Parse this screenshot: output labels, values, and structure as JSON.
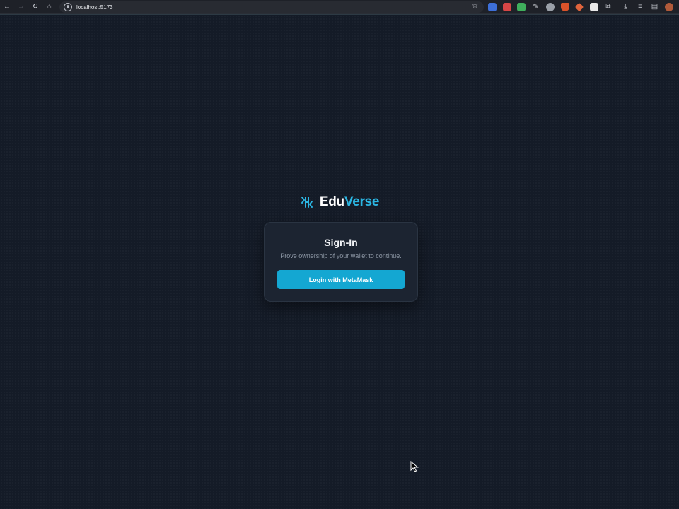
{
  "browser": {
    "url": "localhost:5173",
    "nav": {
      "back": "←",
      "forward": "→",
      "reload": "↻",
      "home": "⌂"
    },
    "bookmark_icon": "star-icon",
    "extensions": [
      {
        "name": "translate-extension-icon",
        "color": "#3d6fd8"
      },
      {
        "name": "red-extension-icon",
        "color": "#d64646"
      },
      {
        "name": "shield-extension-icon",
        "color": "#3fae5c"
      },
      {
        "name": "black-extension-icon",
        "color": "#2b2b2b"
      },
      {
        "name": "gray-shield-extension-icon",
        "color": "#9aa0a8"
      },
      {
        "name": "maple-extension-icon",
        "color": "#d9532a"
      },
      {
        "name": "diamond-extension-icon",
        "color": "#e0643c"
      },
      {
        "name": "info-extension-icon",
        "color": "#e8e8e8"
      },
      {
        "name": "puzzle-extension-icon",
        "color": "#c8cbd2"
      }
    ]
  },
  "brand": {
    "name_part1": "Edu",
    "name_part2": "Verse",
    "accent_color": "#2bb6e3"
  },
  "signin": {
    "title": "Sign-In",
    "subtitle": "Prove ownership of your wallet to continue.",
    "button_label": "Login with MetaMask",
    "button_color": "#14a7d2"
  }
}
